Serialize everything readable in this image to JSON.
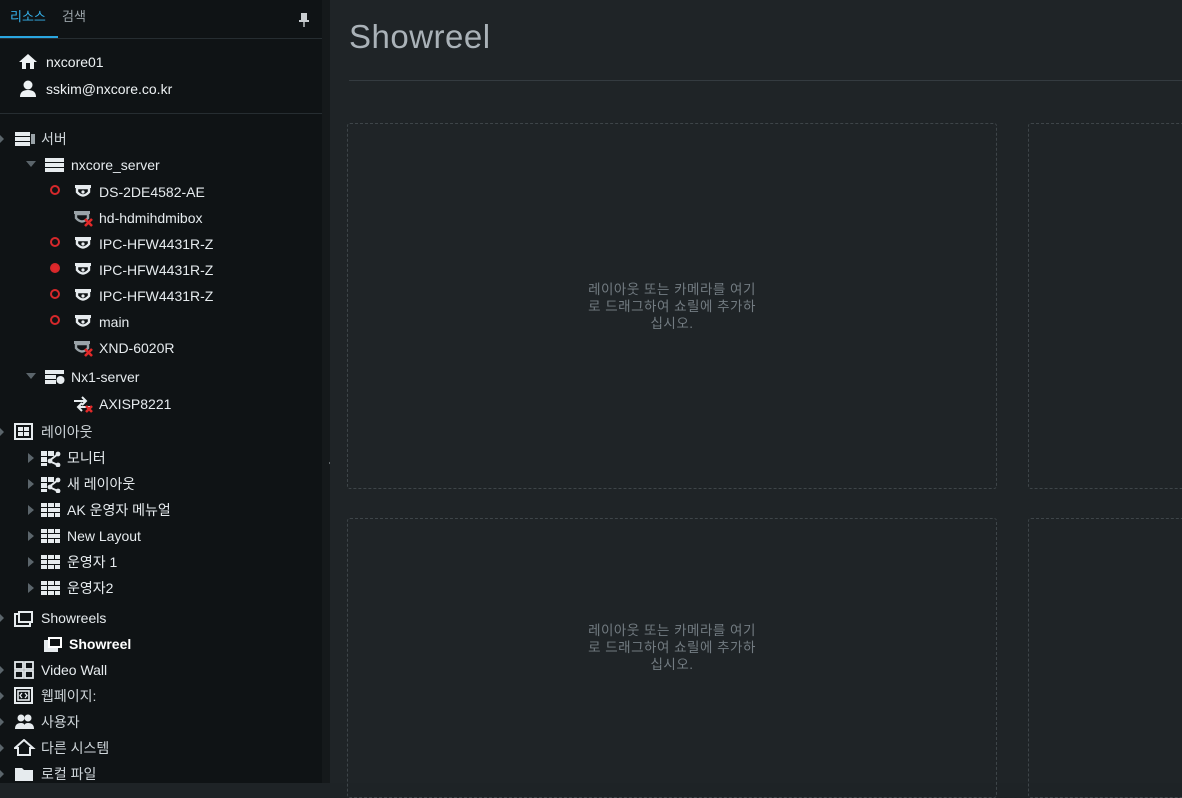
{
  "tabs": {
    "resources": "리소스",
    "search": "검색"
  },
  "system": {
    "name": "nxcore01",
    "user": "sskim@nxcore.co.kr"
  },
  "tree": {
    "servers": {
      "label": "서버",
      "server1": {
        "label": "nxcore_server",
        "devices": [
          {
            "label": "DS-2DE4582-AE",
            "status": "recording-off"
          },
          {
            "label": "hd-hdmihdmibox",
            "status": "offline"
          },
          {
            "label": "IPC-HFW4431R-Z",
            "status": "recording-off"
          },
          {
            "label": "IPC-HFW4431R-Z",
            "status": "recording-on"
          },
          {
            "label": "IPC-HFW4431R-Z",
            "status": "recording-off"
          },
          {
            "label": "main",
            "status": "recording-off"
          },
          {
            "label": "XND-6020R",
            "status": "offline"
          }
        ]
      },
      "server2": {
        "label": "Nx1-server",
        "devices": [
          {
            "label": "AXISP8221",
            "status": "offline"
          }
        ]
      }
    },
    "layouts": {
      "label": "레이아웃",
      "items": [
        "모니터",
        "새 레이아웃",
        "AK 운영자 메뉴얼",
        "New Layout",
        "운영자 1",
        "운영자2"
      ]
    },
    "showreels": {
      "label": "Showreels",
      "items": [
        "Showreel"
      ]
    },
    "videowall": "Video Wall",
    "webpages": "웹페이지:",
    "users": "사용자",
    "other_systems": "다른 시스템",
    "local_files": "로컬 파일"
  },
  "main": {
    "title": "Showreel",
    "drop_hint": "레이아웃 또는 카메라를 여기로 드래그하여 쇼릴에 추가하십시오."
  },
  "colors": {
    "accent": "#2aa6e0",
    "sidebar_bg": "#0f1315",
    "main_bg": "#1f2427",
    "status_red": "#d6282b"
  },
  "icons": [
    "home-icon",
    "user-icon",
    "pin-icon",
    "servers-icon",
    "server-icon",
    "camera-icon",
    "offline-camera-icon",
    "io-module-icon",
    "layout-icon",
    "showreel-icon",
    "videowall-icon",
    "webpage-icon",
    "users-icon",
    "other-systems-icon",
    "folder-icon",
    "collapse-chevron-icon"
  ]
}
